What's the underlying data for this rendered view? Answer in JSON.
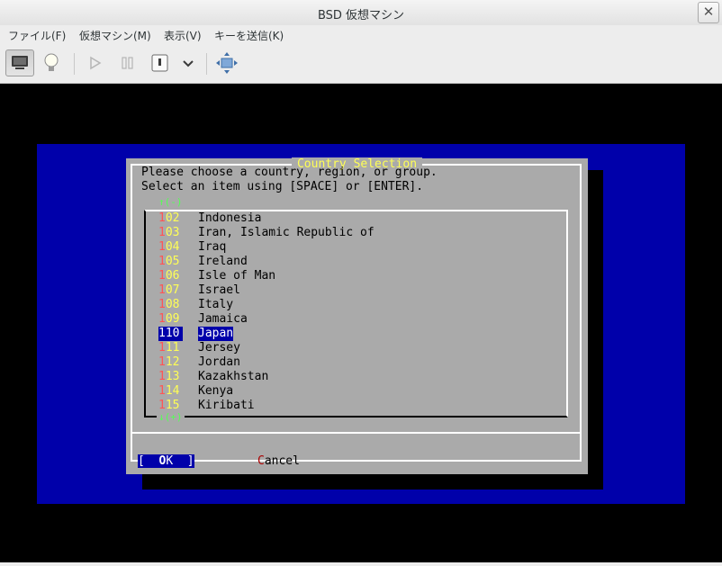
{
  "window": {
    "title": "BSD 仮想マシン"
  },
  "menu": [
    "ファイル(F)",
    "仮想マシン(M)",
    "表示(V)",
    "キーを送信(K)"
  ],
  "toolbar": {
    "icons": [
      "monitor-icon",
      "lightbulb-icon",
      "play-icon",
      "pause-icon",
      "power-icon",
      "chevron-down-icon",
      "fullscreen-icon"
    ]
  },
  "dialog": {
    "title": "Country Selection",
    "prompt_line1": "Please choose a country, region, or group.",
    "prompt_line2": "Select an item using [SPACE] or [ENTER].",
    "scroll_up": "↑(-)",
    "scroll_down": "↓(+)",
    "items": [
      {
        "code_first": "1",
        "code_rest": "02",
        "name": "Indonesia"
      },
      {
        "code_first": "1",
        "code_rest": "03",
        "name": "Iran, Islamic Republic of"
      },
      {
        "code_first": "1",
        "code_rest": "04",
        "name": "Iraq"
      },
      {
        "code_first": "1",
        "code_rest": "05",
        "name": "Ireland"
      },
      {
        "code_first": "1",
        "code_rest": "06",
        "name": "Isle of Man"
      },
      {
        "code_first": "1",
        "code_rest": "07",
        "name": "Israel"
      },
      {
        "code_first": "1",
        "code_rest": "08",
        "name": "Italy"
      },
      {
        "code_first": "1",
        "code_rest": "09",
        "name": "Jamaica"
      },
      {
        "code_first": "1",
        "code_rest": "10",
        "name": "Japan"
      },
      {
        "code_first": "1",
        "code_rest": "11",
        "name": "Jersey"
      },
      {
        "code_first": "1",
        "code_rest": "12",
        "name": "Jordan"
      },
      {
        "code_first": "1",
        "code_rest": "13",
        "name": "Kazakhstan"
      },
      {
        "code_first": "1",
        "code_rest": "14",
        "name": "Kenya"
      },
      {
        "code_first": "1",
        "code_rest": "15",
        "name": "Kiribati"
      }
    ],
    "selected_index": 8,
    "ok_left": "[  ",
    "ok_hot": "O",
    "ok_right": "K  ]",
    "cancel_hot": "C",
    "cancel_rest": "ancel"
  }
}
